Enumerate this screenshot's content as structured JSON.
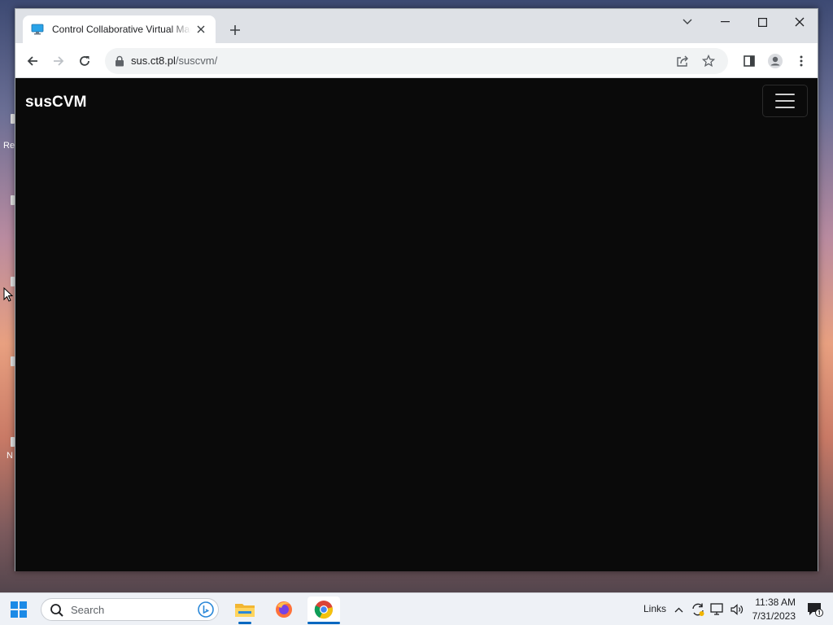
{
  "desktop": {
    "fragments": [
      "Re",
      "N"
    ]
  },
  "browser": {
    "tab": {
      "title": "Control Collaborative Virtual Machine",
      "favicon": "monitor-icon"
    },
    "url": {
      "host": "sus.ct8.pl",
      "path": "/suscvm/"
    },
    "icons": {
      "back": "arrow-left-icon",
      "forward": "arrow-right-icon",
      "reload": "reload-icon",
      "share": "share-icon",
      "bookmark": "star-icon",
      "sidepanel": "side-panel-icon",
      "profile": "profile-icon",
      "menu": "more-vert-icon"
    }
  },
  "page": {
    "brand": "susCVM",
    "background": "#0a0a0a"
  },
  "taskbar": {
    "search_placeholder": "Search",
    "apps": [
      "file-explorer",
      "firefox",
      "chrome"
    ],
    "links_label": "Links",
    "time": "11:38 AM",
    "date": "7/31/2023",
    "accent": "#0067c0"
  }
}
